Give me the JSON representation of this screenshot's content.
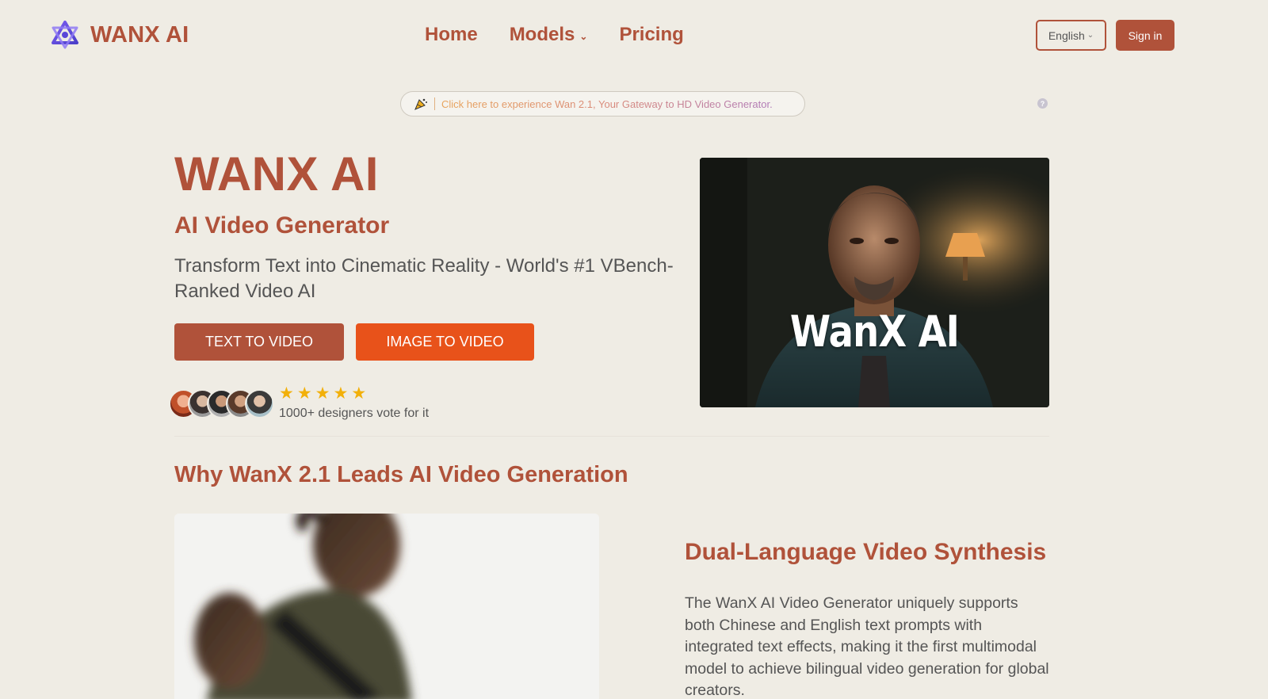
{
  "header": {
    "brand": "WANX AI",
    "nav": [
      {
        "label": "Home"
      },
      {
        "label": "Models"
      },
      {
        "label": "Pricing"
      }
    ],
    "language": "English",
    "signin": "Sign in"
  },
  "announcement": {
    "text": "Click here to experience Wan 2.1, Your Gateway to HD Video Generator."
  },
  "hero": {
    "title": "WANX AI",
    "subtitle": "AI Video Generator",
    "description": "Transform Text into Cinematic Reality - World's #1 VBench-Ranked Video AI",
    "btn_text_to_video": "TEXT TO VIDEO",
    "btn_image_to_video": "IMAGE TO VIDEO",
    "rating": 5,
    "vote_text": "1000+ designers vote for it",
    "image_caption": "WanX AI"
  },
  "section": {
    "title": "Why WanX 2.1 Leads AI Video Generation",
    "feature_title": "Dual-Language Video Synthesis",
    "feature_desc": "The WanX AI Video Generator uniquely supports both Chinese and English text prompts with integrated text effects, making it the first multimodal model to achieve bilingual video generation for global creators."
  },
  "colors": {
    "brand": "#b0523a",
    "accent_orange": "#e8521a",
    "background": "#efece4",
    "star": "#f2b00a"
  }
}
